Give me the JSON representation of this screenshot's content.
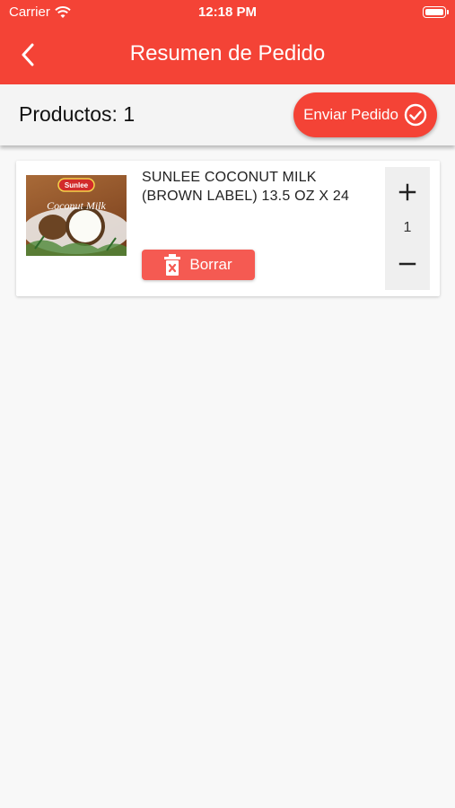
{
  "status_bar": {
    "carrier": "Carrier",
    "time": "12:18 PM"
  },
  "app_bar": {
    "title": "Resumen de Pedido"
  },
  "summary": {
    "products_label": "Productos: 1",
    "send_button": "Enviar Pedido"
  },
  "cart": {
    "items": [
      {
        "name": "SUNLEE COCONUT MILK (BROWN LABEL) 13.5 OZ X 24",
        "quantity": "1",
        "delete_label": "Borrar",
        "image_brand": "Sunlee",
        "image_text": "Coconut Milk"
      }
    ]
  },
  "colors": {
    "primary": "#f44336",
    "background": "#f8f8f8",
    "delete": "#f55a52"
  },
  "icons": [
    "wifi-icon",
    "battery-icon",
    "back-arrow-icon",
    "check-circle-icon",
    "trash-icon",
    "plus-icon",
    "minus-icon"
  ]
}
